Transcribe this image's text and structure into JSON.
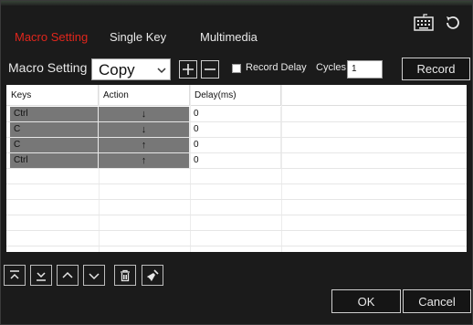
{
  "tabs": [
    {
      "label": "Macro Setting",
      "active": true
    },
    {
      "label": "Single Key",
      "active": false
    },
    {
      "label": "Multimedia",
      "active": false
    }
  ],
  "toolbar": {
    "macro_label": "Macro Setting",
    "macro_select": "Copy",
    "record_delay_label": "Record Delay",
    "record_delay_checked": false,
    "cycles_label": "Cycles",
    "cycles_value": "1",
    "record_button": "Record"
  },
  "table": {
    "headers": [
      "Keys",
      "Action",
      "Delay(ms)"
    ],
    "rows": [
      {
        "key": "Ctrl",
        "action": "↓",
        "delay": "0"
      },
      {
        "key": "C",
        "action": "↓",
        "delay": "0"
      },
      {
        "key": "C",
        "action": "↑",
        "delay": "0"
      },
      {
        "key": "Ctrl",
        "action": "↑",
        "delay": "0"
      }
    ]
  },
  "footer": {
    "ok": "OK",
    "cancel": "Cancel"
  },
  "icons": {
    "keyboard": "keyboard-icon",
    "reset": "reset-icon",
    "add": "plus-icon",
    "remove": "minus-icon",
    "move_top": "move-to-top-icon",
    "move_bottom": "move-to-bottom-icon",
    "move_up": "move-up-icon",
    "move_down": "move-down-icon",
    "delete": "trash-icon",
    "clear": "broom-icon"
  },
  "colors": {
    "active_tab": "#e0261c",
    "background": "#1b1b1b",
    "selected_cell": "#777777"
  }
}
